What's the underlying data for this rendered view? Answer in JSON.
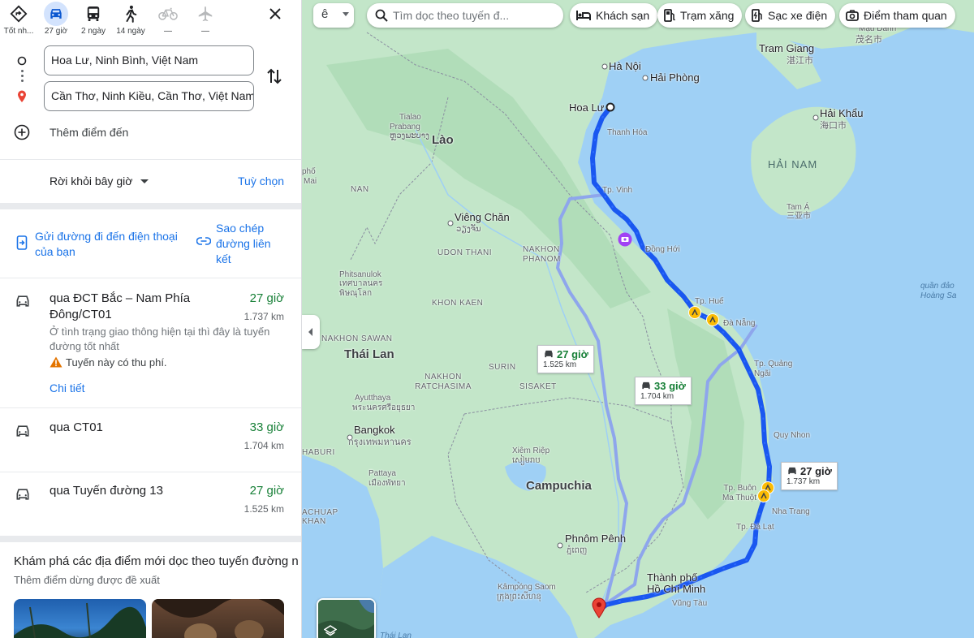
{
  "colors": {
    "accent": "#1a73e8",
    "route_main": "#1a57f0",
    "route_alt": "#8ea6ec",
    "time_green": "#188038",
    "land": "#bfe5c8",
    "sea": "#9fd0f5"
  },
  "modes": [
    {
      "label": "Tốt nh...",
      "icon": "best-route-icon",
      "active": false
    },
    {
      "label": "27 giờ",
      "icon": "car-icon",
      "active": true
    },
    {
      "label": "2 ngày",
      "icon": "bus-icon",
      "active": false
    },
    {
      "label": "14 ngày",
      "icon": "walk-icon",
      "active": false
    },
    {
      "label": "—",
      "icon": "bike-icon",
      "active": false
    },
    {
      "label": "—",
      "icon": "flight-icon",
      "active": false
    }
  ],
  "waypoints": {
    "origin": "Hoa Lư, Ninh Bình, Việt Nam",
    "destination": "Cần Thơ, Ninh Kiều, Cần Thơ, Việt Nam",
    "add_label": "Thêm điểm đến"
  },
  "depart": {
    "label": "Rời khỏi bây giờ",
    "options_label": "Tuỳ chọn"
  },
  "share": {
    "send_to_phone": "Gửi đường đi đến điện thoại của bạn",
    "copy_link": "Sao chép đường liên kết"
  },
  "routes": [
    {
      "name": "qua ĐCT Bắc – Nam Phía Đông/CT01",
      "time": "27 giờ",
      "distance": "1.737 km",
      "desc": "Ở tình trạng giao thông hiện tại thì đây là tuyến đường tốt nhất",
      "toll": "Tuyến này có thu phí.",
      "details": "Chi tiết"
    },
    {
      "name": "qua CT01",
      "time": "33 giờ",
      "distance": "1.704 km"
    },
    {
      "name": "qua Tuyến đường 13",
      "time": "27 giờ",
      "distance": "1.525 km"
    }
  ],
  "explore": {
    "title": "Khám phá các địa điểm mới dọc theo tuyến đường n",
    "subtitle": "Thêm điểm dừng được đề xuất"
  },
  "map": {
    "search_placeholder": "Tìm dọc theo tuyến đ...",
    "layer_glyph": "ê",
    "chips": [
      {
        "label": "Khách sạn",
        "icon": "hotel-icon"
      },
      {
        "label": "Trạm xăng",
        "icon": "gas-station-icon"
      },
      {
        "label": "Sạc xe điện",
        "icon": "ev-charging-icon"
      },
      {
        "label": "Điểm tham quan",
        "icon": "camera-icon"
      }
    ],
    "route_boxes": [
      {
        "time": "27 giờ",
        "distance": "1.525 km"
      },
      {
        "time": "33 giờ",
        "distance": "1.704 km"
      },
      {
        "time": "27 giờ",
        "distance": "1.737 km"
      }
    ],
    "labels": {
      "hanoi": "Hà Nội",
      "haiphong": "Hải Phòng",
      "hoalu": "Hoa Lư",
      "thanhhoa": "Thanh Hóa",
      "vinh": "Tp. Vinh",
      "donghoi": "Đồng Hới",
      "hue": "Tp. Huế",
      "danang": "Đà Nẵng",
      "quangngai": "Tp. Quảng Ngãi",
      "quynhon": "Quy Nhon",
      "buonmathuot": "Tp. Buôn Ma Thuột",
      "nhatrang": "Nha Trang",
      "dalat": "Tp. Đà Lạt",
      "hcm": "Thành phố Hồ Chí Minh",
      "vungtau": "Vũng Tàu",
      "lao": "Lào",
      "vientiane": "Viêng Chăn",
      "vientiane_local": "ວຽງຈັນ",
      "thailand": "Thái Lan",
      "bangkok": "Bangkok",
      "bangkok_local": "กรุงเทพมหานคร",
      "cambodia": "Campuchia",
      "phnompenh": "Phnôm Pênh",
      "phnompenh_local": "ភ្នំពេញ",
      "siemreap": "Xiêm Riệp",
      "siemreap_local": "សៀមរាប",
      "kampongsao": "Kâmpóng Saom",
      "kampongsao_local": "ក្រុងព្រះសីហនុ",
      "pattaya": "Pattaya",
      "pattaya_local": "เมืองพัทยา",
      "ayutthaya": "Ayutthaya",
      "ayutthaya_local": "พระนครศรีอยุธยา",
      "phitsanulok": "Phitsanulok",
      "phitsanulok_local": "เทศบาลนคร พิษณุโลก",
      "prabang": "Prabang",
      "prabang_local": "ຫຼວງພະບາງ",
      "tialao": "Tialao",
      "udon": "UDON THANI",
      "nakhon_phanom": "NAKHON PHANOM",
      "khon_kaen": "KHON KAEN",
      "nakhon_sawan": "NAKHON SAWAN",
      "surin": "SURIN",
      "sisaket": "SISAKET",
      "nakhon_ratchasima": "NAKHON RATCHASIMA",
      "nan": "NAN",
      "trang_giang": "Tram Giang",
      "trang_giang_local": "湛江市",
      "haikhau": "Hải Khẩu",
      "haikhau_local": "海口市",
      "hainam": "HẢI NAM",
      "tam_a": "Tam Á",
      "tam_a_local": "三亚市",
      "maodanh": "Mậu Danh",
      "maodanh_local": "茂名市",
      "hoangsa": "quần đảo Hoàng Sa",
      "thailan_gulf": "Thái Lan",
      "chachuap": "ACHUAP",
      "khan": "KHAN",
      "haburi": "HABURI",
      "pho": "phố",
      "mai": "Mai"
    }
  }
}
